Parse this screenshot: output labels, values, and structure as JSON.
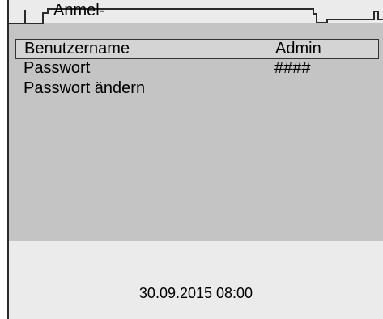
{
  "tab": {
    "title": "Anmel-"
  },
  "menu": {
    "items": [
      {
        "label": "Benutzername",
        "value": "Admin"
      },
      {
        "label": "Passwort",
        "value": "####"
      },
      {
        "label": "Passwort ändern",
        "value": ""
      }
    ]
  },
  "status": {
    "datetime": "30.09.2015 08:00"
  },
  "colors": {
    "screen_background": "#ebebeb",
    "content_background": "#c4c4c4",
    "frame_line": "#2a2a2a"
  }
}
